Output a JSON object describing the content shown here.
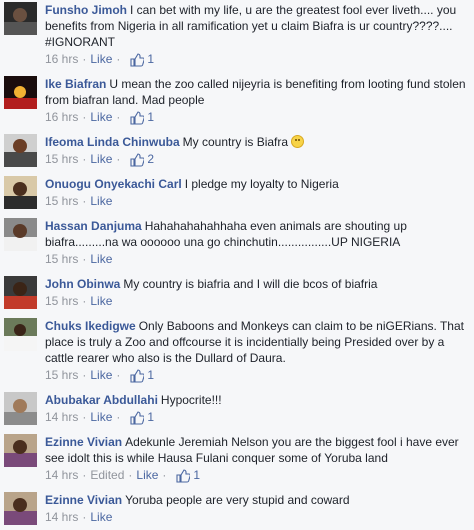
{
  "comments": [
    {
      "author": "Funsho Jimoh",
      "text": "I can bet with my life, u are the greatest fool ever liveth.... you benefits from Nigeria in all ramification yet u claim Biafra is ur country????.... #IGNORANT",
      "time": "16 hrs",
      "edited": "",
      "like_label": "Like",
      "likes": "1",
      "avatar_icon": "profile-photo"
    },
    {
      "author": "Ike Biafran",
      "text": "U mean the zoo called nijeyria is benefiting from looting fund stolen from biafran land. Mad people",
      "time": "16 hrs",
      "edited": "",
      "like_label": "Like",
      "likes": "1",
      "avatar_icon": "profile-photo"
    },
    {
      "author": "Ifeoma Linda Chinwuba",
      "text": "My country is Biafra",
      "time": "15 hrs",
      "edited": "",
      "like_label": "Like",
      "likes": "2",
      "avatar_icon": "profile-photo",
      "emoji": "smile-emoji"
    },
    {
      "author": "Onuogu Onyekachi Carl",
      "text": "I pledge my loyalty to Nigeria",
      "time": "15 hrs",
      "edited": "",
      "like_label": "Like",
      "likes": "",
      "avatar_icon": "profile-photo"
    },
    {
      "author": "Hassan Danjuma",
      "text": "Hahahahahahhaha even animals are shouting up biafra.........na wa oooooo una go chinchutin................UP NIGERIA",
      "time": "15 hrs",
      "edited": "",
      "like_label": "Like",
      "likes": "",
      "avatar_icon": "profile-photo"
    },
    {
      "author": "John Obinwa",
      "text": "My country is biafria and I will die bcos of biafria",
      "time": "15 hrs",
      "edited": "",
      "like_label": "Like",
      "likes": "",
      "avatar_icon": "profile-photo"
    },
    {
      "author": "Chuks Ikedigwe",
      "text": "Only Baboons and Monkeys can claim to be niGERians. That place is truly a Zoo and offcourse it is incidentially being Presided over by a cattle rearer who also is the Dullard of Daura.",
      "time": "15 hrs",
      "edited": "",
      "like_label": "Like",
      "likes": "1",
      "avatar_icon": "profile-photo"
    },
    {
      "author": "Abubakar Abdullahi",
      "text": "Hypocrite!!!",
      "time": "14 hrs",
      "edited": "",
      "like_label": "Like",
      "likes": "1",
      "avatar_icon": "profile-photo"
    },
    {
      "author": "Ezinne Vivian",
      "text": "Adekunle Jeremiah Nelson you are the biggest fool i have ever see idolt this is while Hausa Fulani conquer some of Yoruba land",
      "time": "14 hrs",
      "edited": "Edited",
      "like_label": "Like",
      "likes": "1",
      "avatar_icon": "profile-photo"
    },
    {
      "author": "Ezinne Vivian",
      "text": "Yoruba people are very stupid and coward",
      "time": "14 hrs",
      "edited": "",
      "like_label": "Like",
      "likes": "",
      "avatar_icon": "profile-photo"
    }
  ],
  "colors": {
    "author": "#3b5998",
    "meta": "#90949c",
    "link": "#4b67a1",
    "background": "#f6f7f9"
  }
}
